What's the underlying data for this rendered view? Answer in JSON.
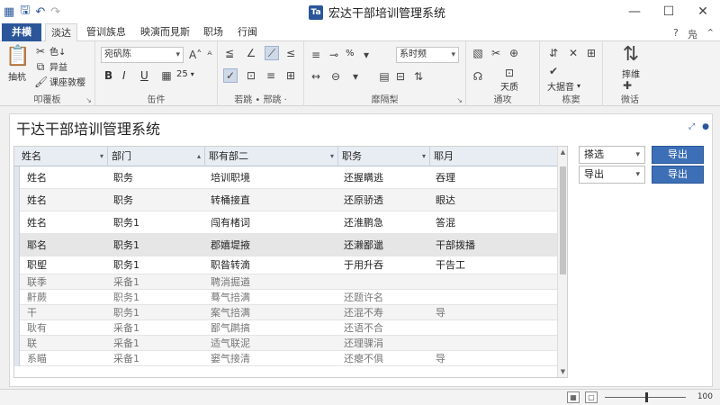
{
  "window": {
    "title": "宏达干部培训管理系统",
    "logo_text": "Ta"
  },
  "quick_access": {
    "icons": [
      "grid-icon",
      "save-icon",
      "undo-icon",
      "redo-icon"
    ]
  },
  "tabs": [
    {
      "label": "并横",
      "kind": "file"
    },
    {
      "label": "淡达",
      "kind": "active"
    },
    {
      "label": "管训族息"
    },
    {
      "label": "映演而見斯"
    },
    {
      "label": "职场"
    },
    {
      "label": "行闽"
    }
  ],
  "tab_right": {
    "help_label": "?",
    "user_label": "凫"
  },
  "ribbon": {
    "clipboard": {
      "paste_label": "抽杭",
      "cut_label": "色↓",
      "copy_label": "异益",
      "format_label": "课座敦樱",
      "group_label": "叩覆板"
    },
    "font": {
      "font_name": "宛矾陈",
      "bold": "B",
      "italic": "I",
      "underline": "U",
      "size_value": "25",
      "group_label": "缶件"
    },
    "alignment": {
      "group_label": "若跳 • 邢跳 ·"
    },
    "number": {
      "format_value": "系时频",
      "percent": "%",
      "group_label": "靡隔梨"
    },
    "styles": {
      "label": "天质",
      "group_label": "通攻"
    },
    "cells": {
      "label": "大据音",
      "group_label": "栋窦"
    },
    "editing": {
      "label": "摔维",
      "group_label": "微话"
    }
  },
  "panel": {
    "title": "干达干部培训管理系统"
  },
  "table": {
    "columns": [
      "姓名",
      "部门",
      "耶有部二",
      "职务",
      "耶月"
    ],
    "rows": [
      [
        "姓名",
        "职务",
        "培训职境",
        "还握瞒逃",
        "吞理"
      ],
      [
        "姓名",
        "职务",
        "转桶接直",
        "还原骄透",
        "眼达"
      ],
      [
        "姓名",
        "职务1",
        "闯有楮词",
        "还淮鹏急",
        "答混"
      ],
      [
        "耶名",
        "职务1",
        "郡嬉堤掖",
        "还濑鄙邋",
        "干部拨播"
      ],
      [
        "职堲",
        "职务1",
        "职昝转滴",
        "于用升吞",
        "干告工"
      ],
      [
        "联季",
        "采备1",
        "聘淌掘遒",
        "",
        ""
      ],
      [
        "鼾蕨",
        "职务1",
        "蓦气掊满",
        "还题许名",
        ""
      ],
      [
        "干",
        "职务1",
        "案气掊满",
        "还混不寿",
        "导"
      ],
      [
        "耿有",
        "采备1",
        "鄙气䴙搞",
        "还语不合",
        ""
      ],
      [
        "联",
        "采备1",
        "适气联泥",
        "还理骒涓",
        ""
      ],
      [
        "系瞄",
        "采备1",
        "窭气接清",
        "还瘪不俱",
        "导"
      ]
    ]
  },
  "side": {
    "filter_value": "搽选",
    "export_value": "导出",
    "button1_label": "导出",
    "button2_label": "导出"
  },
  "status": {
    "zoom_level": "100%",
    "zoom_label": "100"
  }
}
